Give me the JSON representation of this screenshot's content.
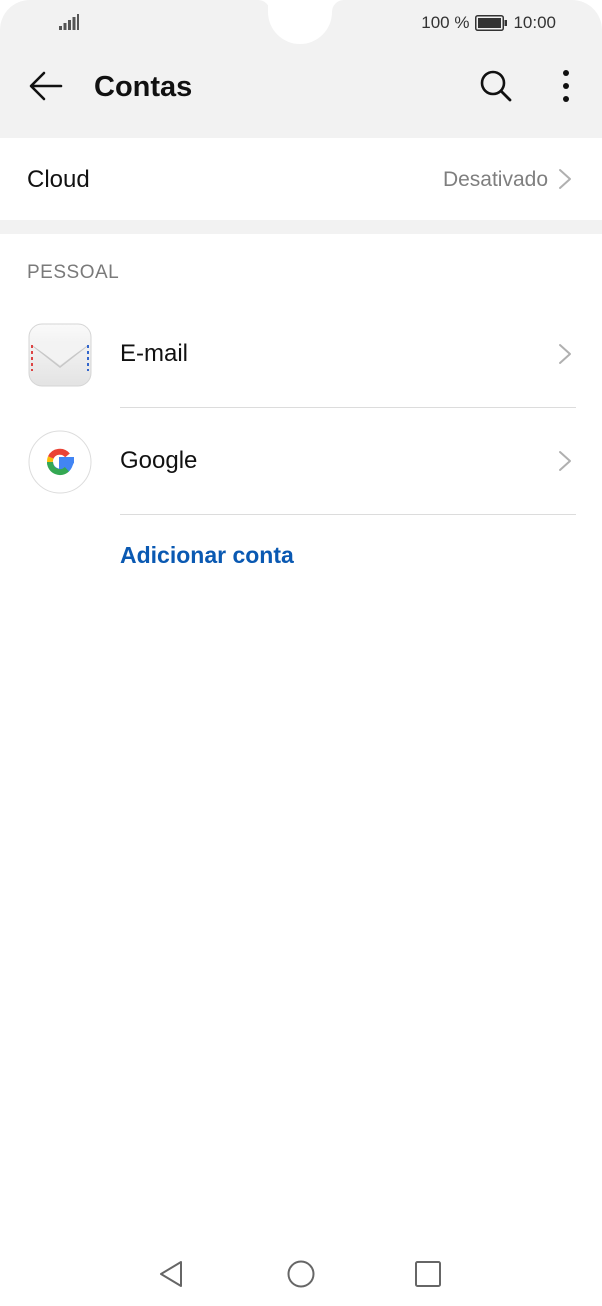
{
  "status_bar": {
    "battery_percent": "100 %",
    "time": "10:00",
    "icons": [
      "signal-icon",
      "battery-icon"
    ]
  },
  "app_bar": {
    "title": "Contas",
    "icons": [
      "back-arrow-icon",
      "search-icon",
      "more-vert-icon"
    ]
  },
  "cloud": {
    "label": "Cloud",
    "value": "Desativado"
  },
  "personal": {
    "header": "PESSOAL",
    "accounts": [
      {
        "label": "E-mail",
        "icon": "email-envelope-icon"
      },
      {
        "label": "Google",
        "icon": "google-icon"
      }
    ],
    "add_account_label": "Adicionar conta"
  },
  "nav_bar": {
    "icons": [
      "nav-back-icon",
      "nav-home-icon",
      "nav-recents-icon"
    ]
  },
  "colors": {
    "accent": "#0a59b2",
    "header_bg": "#f2f2f2",
    "secondary_text": "#7f7f7f"
  }
}
